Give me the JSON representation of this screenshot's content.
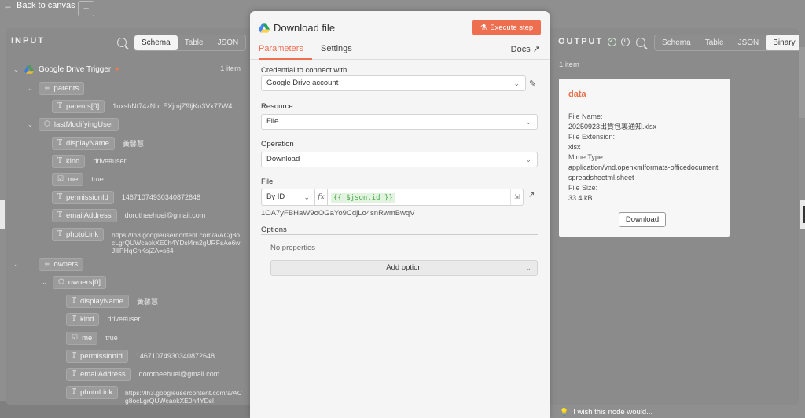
{
  "nav": {
    "back_label": "Back to canvas",
    "plus": "+"
  },
  "input": {
    "header": "INPUT",
    "tabs": [
      "Schema",
      "Table",
      "JSON"
    ],
    "trigger": {
      "name": "Google Drive Trigger",
      "count": "1 item"
    },
    "fields": {
      "parents": "parents",
      "parents0": "parents[0]",
      "parents0_val": "1uxshNt74zNhLEXjmjZ9ljKu3Vx77W4Ll",
      "lastModifyingUser": "lastModifyingUser",
      "displayName": "displayName",
      "displayName_val": "黃馨慧",
      "kind": "kind",
      "kind_val": "drive#user",
      "me": "me",
      "me_val": "true",
      "permissionId": "permissionId",
      "permissionId_val": "14671074930340872648",
      "emailAddress": "emailAddress",
      "emailAddress_val": "dorotheehuei@gmail.com",
      "photoLink": "photoLink",
      "photoLink_val": "https://lh3.googleusercontent.com/a/ACg8ocLgrQUWcaokXE0h4YDsl4rn2gURFsAe6wlJlllPHqCnKsjZA=s64",
      "owners": "owners",
      "owners0": "owners[0]",
      "o_displayName_val": "黃馨慧",
      "o_kind_val": "drive#user",
      "o_me_val": "true",
      "o_permissionId_val": "14671074930340872648",
      "o_emailAddress_val": "dorotheehuei@gmail.com",
      "o_photoLink_val": "https://lh3.googleusercontent.com/a/ACg8ocLgrQUWcaokXE0h4YDsl"
    }
  },
  "modal": {
    "title": "Download file",
    "execute_label": "Execute step",
    "tabs": {
      "parameters": "Parameters",
      "settings": "Settings",
      "docs": "Docs"
    },
    "credential_label": "Credential to connect with",
    "credential_value": "Google Drive account",
    "resource_label": "Resource",
    "resource_value": "File",
    "operation_label": "Operation",
    "operation_value": "Download",
    "file_label": "File",
    "file_mode": "By ID",
    "fx": "fx",
    "file_expr": "{{ $json.id }}",
    "file_resolved": "1OA7yFBHaW9oOGaYo9CdjLo4snRwmBwqV",
    "options_label": "Options",
    "no_props": "No properties",
    "add_option": "Add option"
  },
  "output": {
    "header": "OUTPUT",
    "tabs": [
      "Schema",
      "Table",
      "JSON",
      "Binary"
    ],
    "count": "1 item",
    "card": {
      "title": "data",
      "file_name_k": "File Name:",
      "file_name_v": "20250923出貨包裏通知.xlsx",
      "file_ext_k": "File Extension:",
      "file_ext_v": "xlsx",
      "mime_k": "Mime Type:",
      "mime_v": "application/vnd.openxmlformats-officedocument.spreadsheetml.sheet",
      "size_k": "File Size:",
      "size_v": "33.4 kB",
      "download": "Download"
    }
  },
  "footer": {
    "wish": "I wish this node would..."
  },
  "colors": {
    "accent": "#ee6e50",
    "success": "#cde8cf",
    "expr_green": "#4ba84b"
  }
}
